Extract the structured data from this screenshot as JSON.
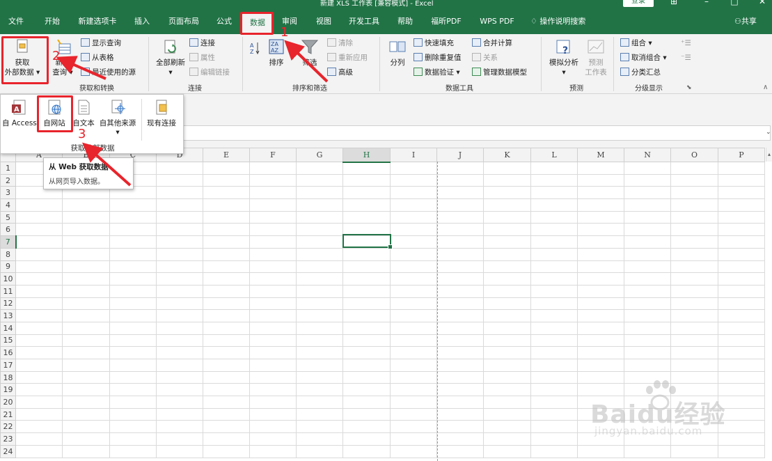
{
  "window": {
    "title": "新建 XLS 工作表 [兼容模式] - Excel",
    "login_label": "登录"
  },
  "menu": {
    "tabs": [
      "文件",
      "开始",
      "新建选项卡",
      "插入",
      "页面布局",
      "公式",
      "数据",
      "审阅",
      "视图",
      "开发工具",
      "帮助",
      "福昕PDF",
      "WPS PDF"
    ],
    "active_tab": "数据",
    "tell_me": "操作说明搜索",
    "share": "共享"
  },
  "ribbon": {
    "get_external": {
      "label1": "获取",
      "label2": "外部数据"
    },
    "new_query": {
      "label1": "新建",
      "label2": "查询"
    },
    "show_queries": "显示查询",
    "from_table": "从表格",
    "recent_sources": "最近使用的源",
    "group_get_transform": "获取和转换",
    "refresh_all": "全部刷新",
    "connections": "连接",
    "properties": "属性",
    "edit_links": "编辑链接",
    "group_connections": "连接",
    "sort": "排序",
    "filter": "筛选",
    "clear": "清除",
    "reapply": "重新应用",
    "advanced": "高级",
    "group_sort_filter": "排序和筛选",
    "text_to_columns": "分列",
    "flash_fill": "快速填充",
    "remove_duplicates": "删除重复值",
    "data_validation": "数据验证",
    "consolidate": "合并计算",
    "relationships": "关系",
    "manage_model": "管理数据模型",
    "group_data_tools": "数据工具",
    "what_if": "模拟分析",
    "forecast_sheet": {
      "label1": "预测",
      "label2": "工作表"
    },
    "group_forecast": "预测",
    "group_btn": "组合",
    "ungroup": "取消组合",
    "subtotal": "分类汇总",
    "group_outline": "分级显示"
  },
  "dropdown": {
    "items": [
      "自 Access",
      "自网站",
      "自文本",
      "自其他来源",
      "现有连接"
    ],
    "group_label": "获取外部数据"
  },
  "tooltip": {
    "title": "从 Web 获取数据",
    "desc": "从网页导入数据。"
  },
  "sheet": {
    "columns": [
      "A",
      "B",
      "C",
      "D",
      "E",
      "F",
      "G",
      "H",
      "I",
      "J",
      "K",
      "L",
      "M",
      "N",
      "O",
      "P"
    ],
    "rows": [
      "1",
      "2",
      "3",
      "4",
      "5",
      "6",
      "7",
      "8",
      "9",
      "10",
      "11",
      "12",
      "13",
      "14",
      "15",
      "16",
      "17",
      "18",
      "19",
      "20",
      "21",
      "22",
      "23",
      "24"
    ],
    "active_cell": "H7"
  },
  "annotations": [
    "1",
    "2",
    "3"
  ],
  "watermark": {
    "text": "Baidu经验",
    "sub": "jingyan.baidu.com"
  },
  "colors": {
    "excel_green": "#217346",
    "annotation_red": "#e8242c"
  }
}
